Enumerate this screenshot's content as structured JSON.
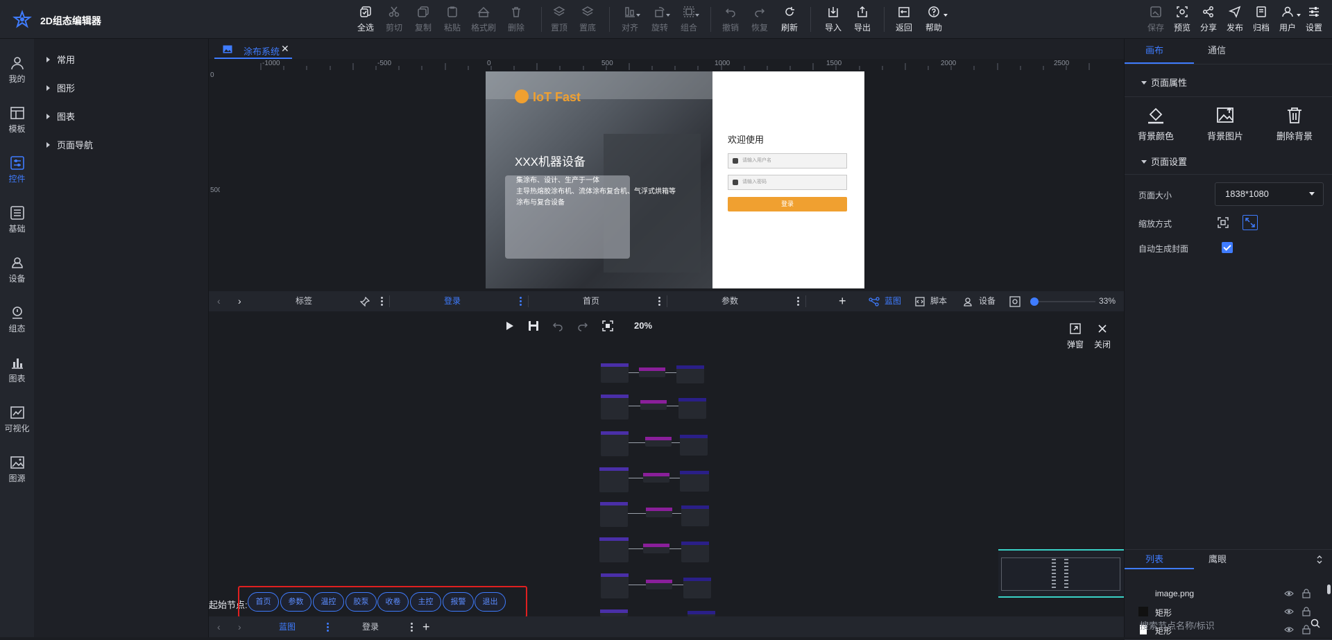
{
  "app": {
    "title": "2D组态编辑器"
  },
  "toolbar": {
    "select_all": "全选",
    "cut": "剪切",
    "copy": "复制",
    "paste": "粘贴",
    "format_brush": "格式刷",
    "delete": "删除",
    "to_top": "置顶",
    "to_bottom": "置底",
    "align": "对齐",
    "rotate": "旋转",
    "group": "组合",
    "undo": "撤销",
    "redo": "恢复",
    "refresh": "刷新",
    "import": "导入",
    "export": "导出",
    "back": "返回",
    "help": "帮助",
    "save": "保存",
    "preview": "预览",
    "share": "分享",
    "publish": "发布",
    "archive": "归档",
    "user": "用户",
    "settings": "设置"
  },
  "leftnav": [
    "我的",
    "模板",
    "控件",
    "基础",
    "设备",
    "组态",
    "图表",
    "可视化",
    "图源"
  ],
  "leftnav_active": "控件",
  "component_tree": [
    "常用",
    "图形",
    "图表",
    "页面导航"
  ],
  "doc_tab": {
    "name": "涂布系统"
  },
  "ruler": {
    "h": [
      "-1000",
      "-500",
      "0",
      "500",
      "1000",
      "1500",
      "2000",
      "2500"
    ],
    "v": [
      "0",
      "500"
    ]
  },
  "canvas_page": {
    "brand": "IoT Fast",
    "hero_title": "XXX机器设备",
    "hero_lines": [
      "集涂布、设计、生产于一体",
      "主导热熔胶涂布机、流体涂布复合机、气浮式烘箱等",
      "涂布与复合设备"
    ],
    "welcome": "欢迎使用",
    "username_placeholder": "请输入用户名",
    "password_placeholder": "请输入密码",
    "login_button": "登录"
  },
  "page_tabs": {
    "label": "标签",
    "tabs": [
      "登录",
      "首页",
      "参数"
    ],
    "active": "登录",
    "blueprint": "蓝图",
    "script": "脚本",
    "device": "设备",
    "zoom": "33%"
  },
  "blueprint": {
    "zoom": "20%",
    "popup": "弹窗",
    "close": "关闭",
    "start_label": "起始节点:",
    "start_nodes": [
      "首页",
      "参数",
      "温控",
      "胶泵",
      "收卷",
      "主控",
      "报警",
      "退出"
    ]
  },
  "bottom_tabs": {
    "tabs": [
      "蓝图",
      "登录"
    ],
    "active": "蓝图"
  },
  "right_panel": {
    "tabs": [
      "画布",
      "通信"
    ],
    "active_tab": "画布",
    "page_props_title": "页面属性",
    "bg_color": "背景颜色",
    "bg_image": "背景图片",
    "bg_delete": "删除背景",
    "page_settings_title": "页面设置",
    "page_size_label": "页面大小",
    "page_size_value": "1838*1080",
    "scale_label": "缩放方式",
    "auto_cover_label": "自动生成封面",
    "auto_cover_checked": true,
    "layer_tabs": [
      "列表",
      "鹰眼"
    ],
    "layer_active": "列表",
    "layers": [
      {
        "name": "image.png",
        "swatch": ""
      },
      {
        "name": "矩形",
        "swatch": "#111111"
      },
      {
        "name": "矩形",
        "swatch": "#ffffff"
      }
    ],
    "search_placeholder": "搜索节点名称/标识"
  },
  "colors": {
    "accent": "#3f7cff",
    "brand_orange": "#f0a030",
    "highlight_red": "#e02020",
    "minimap_cyan": "#3ad1c6"
  }
}
